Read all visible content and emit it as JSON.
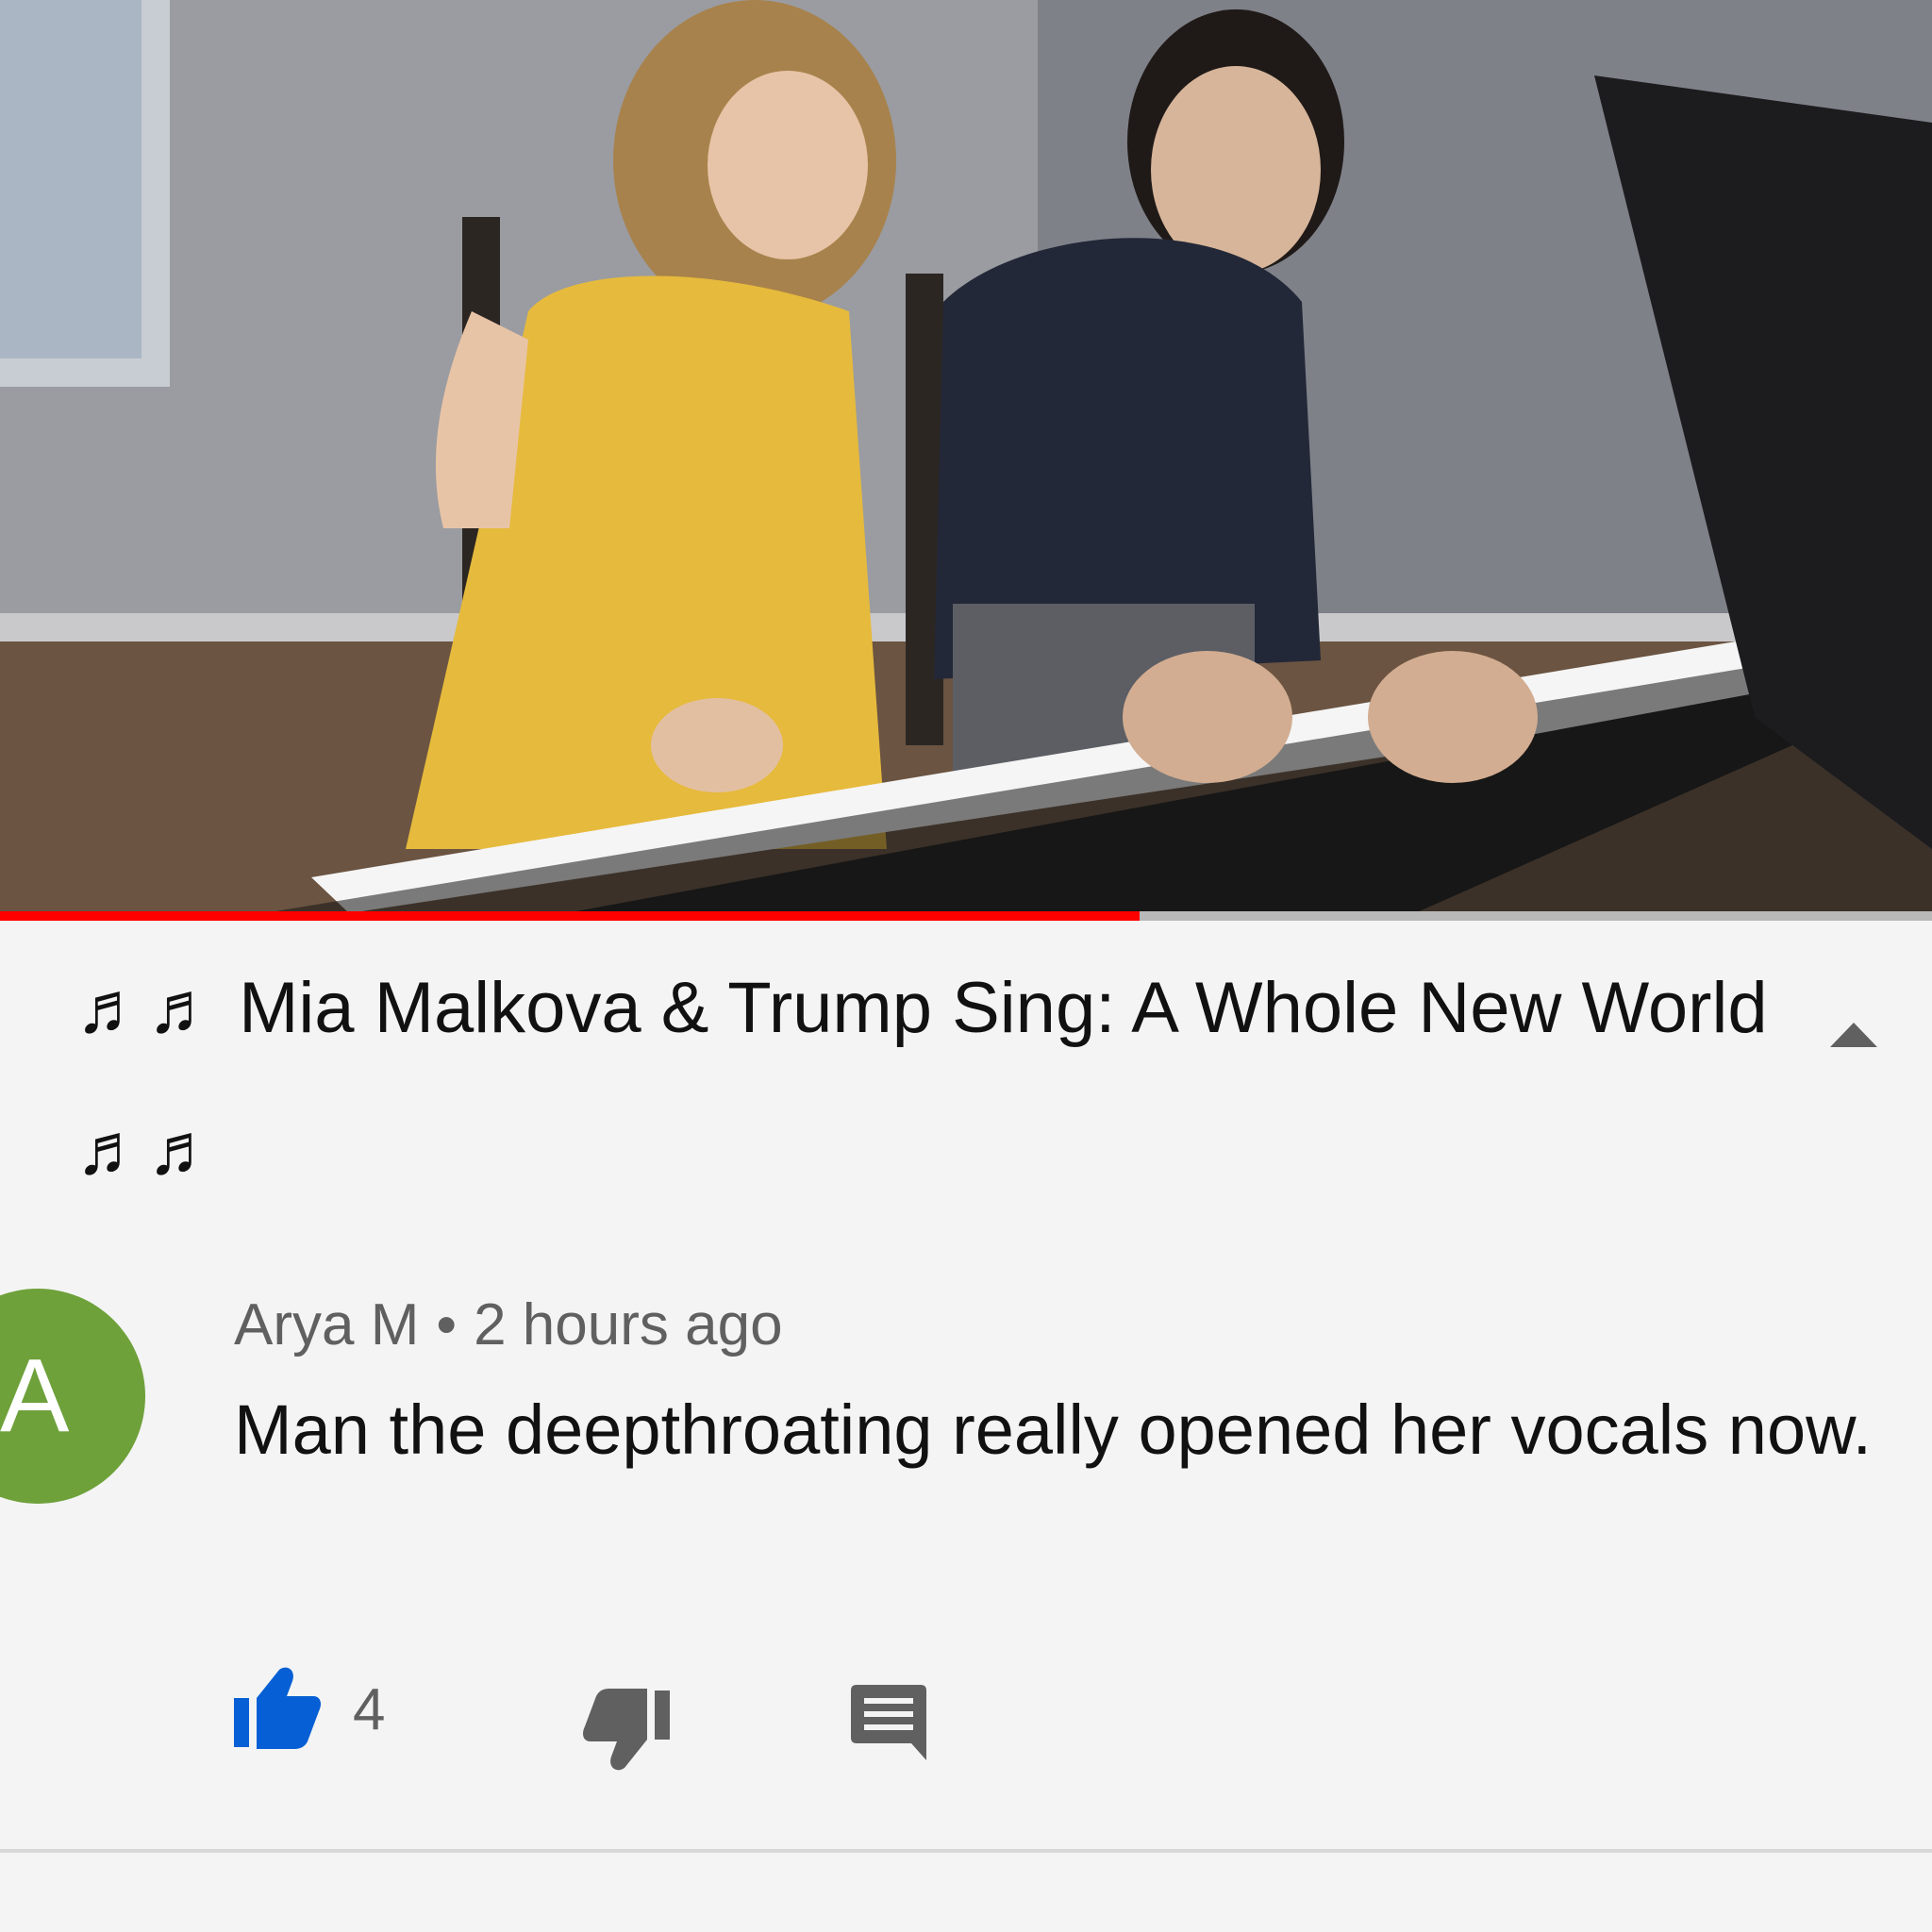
{
  "video": {
    "progress_fraction": 0.59
  },
  "title": {
    "text": "♬♬ Mia Malkova & Trump Sing: A Whole New World ♬♬"
  },
  "comment": {
    "avatar_letter": "A",
    "author": "Arya M",
    "separator": "•",
    "time": "2 hours ago",
    "text": "Man the deepthroating really opened her vocals now.",
    "like_count": "4"
  },
  "colors": {
    "progress": "#ff0000",
    "like_active": "#065fd4",
    "avatar": "#6ea13a"
  },
  "icons": {
    "collapse": "chevron-up-icon",
    "like": "thumbs-up-icon",
    "dislike": "thumbs-down-icon",
    "reply": "comment-icon"
  }
}
